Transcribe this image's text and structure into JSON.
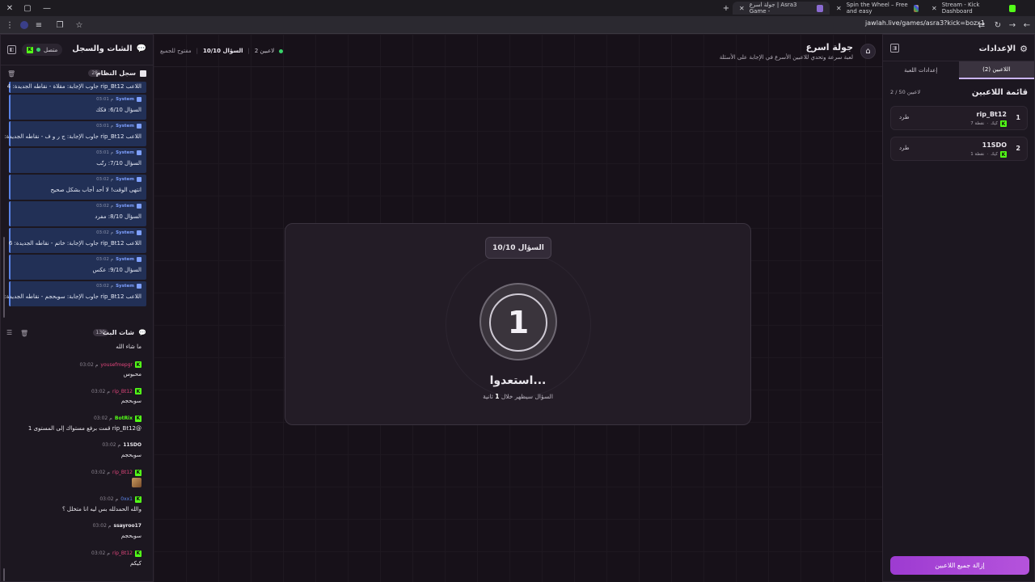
{
  "browser": {
    "tabs": [
      {
        "title": "جولة اسرع | Asra3 Game -",
        "active": true
      },
      {
        "title": "Spin the Wheel – Free and easy",
        "active": false
      },
      {
        "title": "Stream - Kick Dashboard",
        "active": false
      }
    ],
    "url": "jawlah.live/games/asra3?kick=bozx1"
  },
  "chat_panel": {
    "title": "الشات والسجل",
    "status": "متصل",
    "system_log": {
      "title": "سجل النظام",
      "count": "28",
      "entries": [
        {
          "sender": "",
          "time": "",
          "text": "اللاعب rip_Bt12 جاوب الإجابة: مقلاة - نقاطه الجديدة: 4"
        },
        {
          "sender": "System",
          "time": "03:01 م",
          "text": "السؤال 6/10: فكك"
        },
        {
          "sender": "System",
          "time": "03:01 م",
          "text": "اللاعب rip_Bt12 جاوب الإجابة: ج ر و ف - نقاطه الجديدة: 5"
        },
        {
          "sender": "System",
          "time": "03:01 م",
          "text": "السؤال 7/10: رتّب"
        },
        {
          "sender": "System",
          "time": "03:02 م",
          "text": "انتهى الوقت! لا أحد أجاب بشكل صحيح"
        },
        {
          "sender": "System",
          "time": "03:02 م",
          "text": "السؤال 8/10: مفرد"
        },
        {
          "sender": "System",
          "time": "03:02 م",
          "text": "اللاعب rip_Bt12 جاوب الإجابة: خاتم - نقاطه الجديدة: 6"
        },
        {
          "sender": "System",
          "time": "03:02 م",
          "text": "السؤال 9/10: عكس"
        },
        {
          "sender": "System",
          "time": "03:02 م",
          "text": "اللاعب rip_Bt12 جاوب الإجابة: سوبحجم - نقاطه الجديدة: 7"
        }
      ]
    },
    "stream_chat": {
      "title": "شات البث",
      "count": "130",
      "messages": [
        {
          "user": "",
          "time": "",
          "text": "ما شاء الله",
          "color": "#e9e6ec"
        },
        {
          "user": "yousefmepgr",
          "time": "03:02 م",
          "text": "محبوس",
          "color": "#e0457b"
        },
        {
          "user": "rip_Bt12",
          "time": "03:02 م",
          "text": "سوبحجم",
          "color": "#e0457b"
        },
        {
          "user": "BotRix",
          "time": "03:02 م",
          "text": "@rip_Bt12 قمت برفع مستواك إلى المستوى 1",
          "color": "#53fc18"
        },
        {
          "user": "11SDO",
          "time": "03:02 م",
          "text": "سوبحجم",
          "color": "#e9e6ec"
        },
        {
          "user": "rip_Bt12",
          "time": "03:02 م",
          "text": "",
          "color": "#e0457b",
          "emote": true
        },
        {
          "user": "0xx1",
          "time": "03:02 م",
          "text": "والله الحمدلله بس ليه انا متخلل ؟",
          "color": "#5a84e8"
        },
        {
          "user": "ssayroo17",
          "time": "03:02 م",
          "text": "سوبحجم",
          "color": "#e9e6ec"
        },
        {
          "user": "rip_Bt12",
          "time": "03:02 م",
          "text": "كيكم",
          "color": "#e0457b"
        }
      ]
    }
  },
  "game": {
    "title": "جولة اسرع",
    "subtitle": "لعبة سرعة وتحدي للاعبين الأسرع في الإجابة على الأسئلة",
    "players_info": "2 لاعبين",
    "question_info": "السؤال 10/10",
    "open_info": "مفتوح للجميع",
    "card": {
      "question_label": "السؤال 10/10",
      "countdown": "1",
      "ready_text": "استعدوا...",
      "sub_pre": "السؤال سيظهر خلال",
      "sub_num": "1",
      "sub_post": "ثانية"
    }
  },
  "settings_panel": {
    "title": "الإعدادات",
    "tabs": {
      "players": "اللاعبين (2)",
      "game_settings": "إعدادات اللعبة"
    },
    "players_list_title": "قائمة اللاعبين",
    "players_count": "2 / 50 لاعبين",
    "kick_label": "طرد",
    "players": [
      {
        "rank": "1",
        "name": "rip_Bt12",
        "platform": "كيك",
        "points": "7 نقطة"
      },
      {
        "rank": "2",
        "name": "11SDO",
        "platform": "كيك",
        "points": "1 نقطة"
      }
    ],
    "remove_all": "إزالة جميع اللاعبين"
  },
  "colors": {
    "accent": "#b553dc",
    "kick_green": "#53fc18",
    "log_blue": "#223056"
  }
}
